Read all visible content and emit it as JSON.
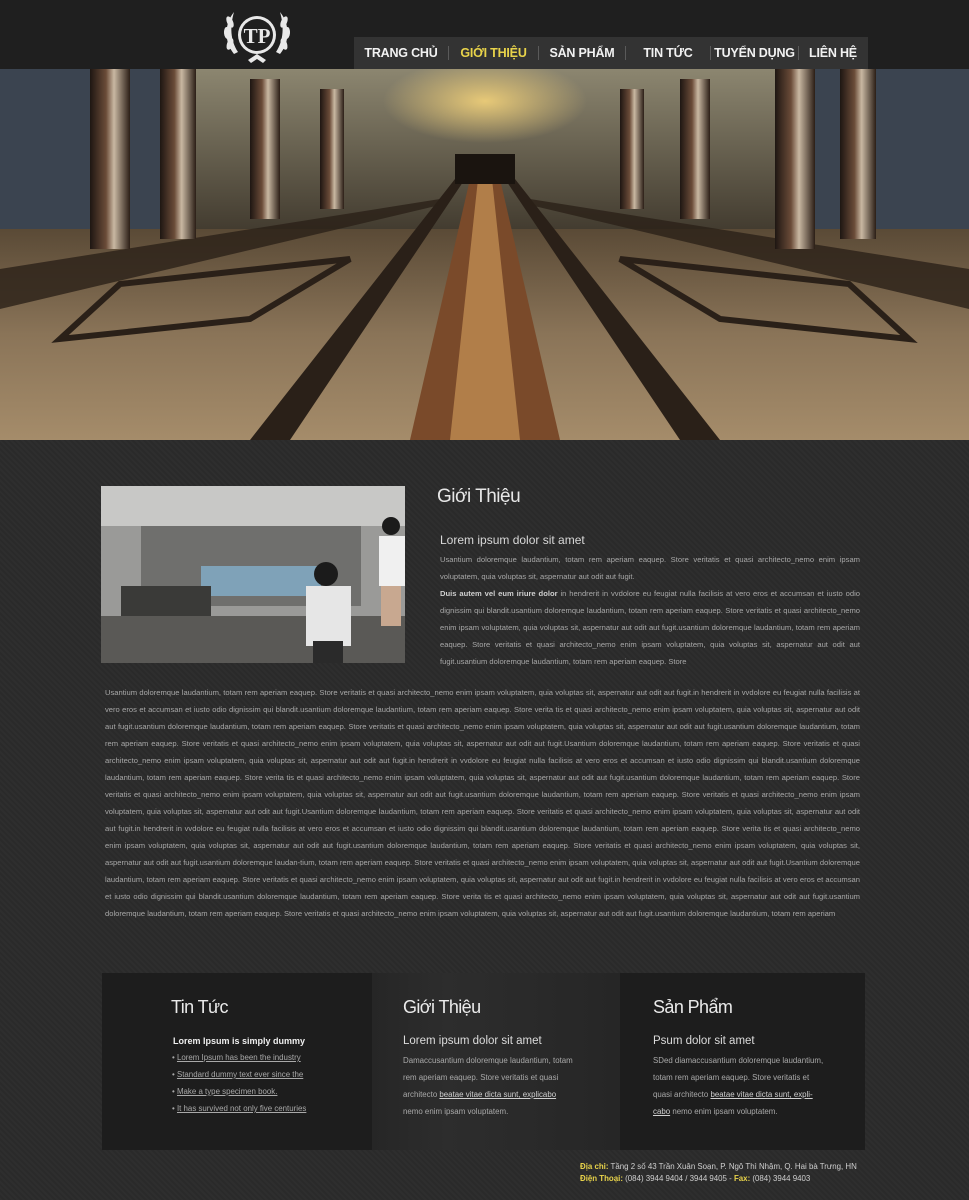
{
  "logo": {
    "text": "TP"
  },
  "nav": [
    {
      "label": "TRANG CHỦ",
      "active": false
    },
    {
      "label": "GIỚI THIỆU",
      "active": true
    },
    {
      "label": "SẢN PHẨM",
      "active": false
    },
    {
      "label": "TIN TỨC",
      "active": false
    },
    {
      "label": "TUYỂN DỤNG",
      "active": false
    },
    {
      "label": "LIÊN HỆ",
      "active": false
    }
  ],
  "intro": {
    "title": "Giới Thiệu",
    "subtitle": "Lorem ipsum dolor sit amet",
    "p1": "Usantium doloremque laudantium, totam rem aperiam eaquep. Store veritatis et quasi architecto_nemo enim ipsam voluptatem, quia voluptas sit, aspernatur aut odit aut fugit.",
    "p2_bold": "Duis autem vel eum iriure dolor",
    "p2": " in hendrerit in vvdolore eu feugiat nulla facilisis at vero eros et accumsan et iusto odio dignissim qui blandit.usantium doloremque laudantium, totam rem aperiam eaquep. Store veritatis et quasi architecto_nemo enim ipsam voluptatem, quia voluptas sit, aspernatur aut odit aut fugit.usantium doloremque laudantium, totam rem aperiam eaquep. Store veritatis et quasi architecto_nemo enim ipsam voluptatem, quia voluptas sit, aspernatur aut odit aut fugit.usantium doloremque laudantium, totam rem aperiam eaquep. Store",
    "body": "Usantium doloremque laudantium, totam rem aperiam eaquep. Store veritatis et quasi architecto_nemo enim ipsam voluptatem, quia voluptas sit, aspernatur aut odit aut fugit.in hendrerit in vvdolore eu feugiat nulla facilisis at vero eros et accumsan et iusto odio dignissim qui blandit.usantium doloremque laudantium, totam rem aperiam eaquep. Store verita tis et quasi architecto_nemo enim ipsam voluptatem, quia voluptas sit, aspernatur aut odit aut fugit.usantium doloremque laudantium, totam rem aperiam eaquep. Store veritatis et quasi architecto_nemo enim ipsam voluptatem, quia voluptas sit, aspernatur aut odit aut fugit.usantium doloremque laudantium, totam rem aperiam eaquep. Store veritatis et quasi architecto_nemo enim ipsam voluptatem, quia voluptas sit, aspernatur aut odit aut fugit.Usantium doloremque laudantium, totam rem aperiam eaquep. Store veritatis et quasi architecto_nemo enim ipsam voluptatem, quia voluptas sit, aspernatur aut odit aut fugit.in hendrerit in vvdolore eu feugiat nulla facilisis at vero eros et accumsan et iusto odio dignissim qui blandit.usantium doloremque laudantium, totam rem aperiam eaquep. Store verita tis et quasi architecto_nemo enim ipsam voluptatem, quia voluptas sit, aspernatur aut odit aut fugit.usantium doloremque laudantium, totam rem aperiam eaquep. Store veritatis et quasi architecto_nemo enim ipsam voluptatem, quia voluptas sit, aspernatur aut odit aut fugit.usantium doloremque laudantium, totam rem aperiam eaquep. Store veritatis et quasi architecto_nemo enim ipsam voluptatem, quia voluptas sit, aspernatur aut odit aut fugit.Usantium doloremque laudantium, totam rem aperiam eaquep. Store veritatis et quasi architecto_nemo enim ipsam voluptatem, quia voluptas sit, aspernatur aut odit aut fugit.in hendrerit in vvdolore eu feugiat nulla facilisis at vero eros et accumsan et iusto odio dignissim qui blandit.usantium doloremque laudantium, totam rem aperiam eaquep. Store verita tis et quasi architecto_nemo enim ipsam voluptatem, quia voluptas sit, aspernatur aut odit aut fugit.usantium doloremque laudantium, totam rem aperiam eaquep. Store veritatis et quasi architecto_nemo enim ipsam voluptatem, quia voluptas sit, aspernatur aut odit aut fugit.usantium doloremque laudan-tium, totam rem aperiam eaquep. Store veritatis et quasi architecto_nemo enim ipsam voluptatem, quia voluptas sit, aspernatur aut odit aut fugit.Usantium doloremque laudantium, totam rem aperiam eaquep. Store veritatis et quasi architecto_nemo enim ipsam voluptatem, quia voluptas sit, aspernatur aut odit aut fugit.in hendrerit in vvdolore eu feugiat nulla facilisis at vero eros et accumsan et iusto odio dignissim qui blandit.usantium doloremque laudantium, totam rem aperiam eaquep. Store verita tis et quasi architecto_nemo enim ipsam voluptatem, quia voluptas sit, aspernatur aut odit aut fugit.usantium doloremque laudantium, totam rem aperiam eaquep. Store veritatis et quasi architecto_nemo enim ipsam voluptatem, quia voluptas sit, aspernatur aut odit aut fugit.usantium doloremque laudantium, totam rem aperiam"
  },
  "news": {
    "title": "Tin Tức",
    "heading": "Lorem Ipsum is simply dummy",
    "items": [
      "Lorem Ipsum has been the industry",
      "Standard dummy text ever since the",
      "Make a type specimen book.",
      "It has survived not only five centuries"
    ]
  },
  "about": {
    "title": "Giới Thiệu",
    "subtitle": "Lorem ipsum dolor sit amet",
    "line1": "Damaccusantium doloremque laudantium, totam",
    "line2": "rem aperiam eaquep. Store veritatis et quasi",
    "line3_pre": "architecto ",
    "line3_link": "beatae vitae dicta sunt, explicabo",
    "line4": "nemo enim ipsam voluptatem."
  },
  "products": {
    "title": "Sản Phẩm",
    "subtitle": "Psum dolor sit amet",
    "line1": "SDed diamaccusantium doloremque laudantium,",
    "line2": "totam rem aperiam eaquep. Store veritatis et",
    "line3_pre": "quasi architecto ",
    "line3_link": "beatae vitae dicta sunt, expli-",
    "line4_link": "cabo",
    "line4": " nemo enim ipsam voluptatem."
  },
  "footer": {
    "address_label": "Địa chỉ:",
    "address": " Tầng 2 số 43 Trần Xuân Soạn, P. Ngô Thì Nhậm, Q. Hai bà Trưng, HN",
    "phone_label": "Điện Thoại:",
    "phone": " (084) 3944 9404 / 3944 9405  -  ",
    "fax_label": "Fax:",
    "fax": " (084) 3944 9403"
  },
  "colors": {
    "accent": "#e8d34a",
    "background": "#2b2b2b",
    "header": "#1f1f1f"
  },
  "icons": {
    "logo": "laurel-wreath-logo"
  }
}
